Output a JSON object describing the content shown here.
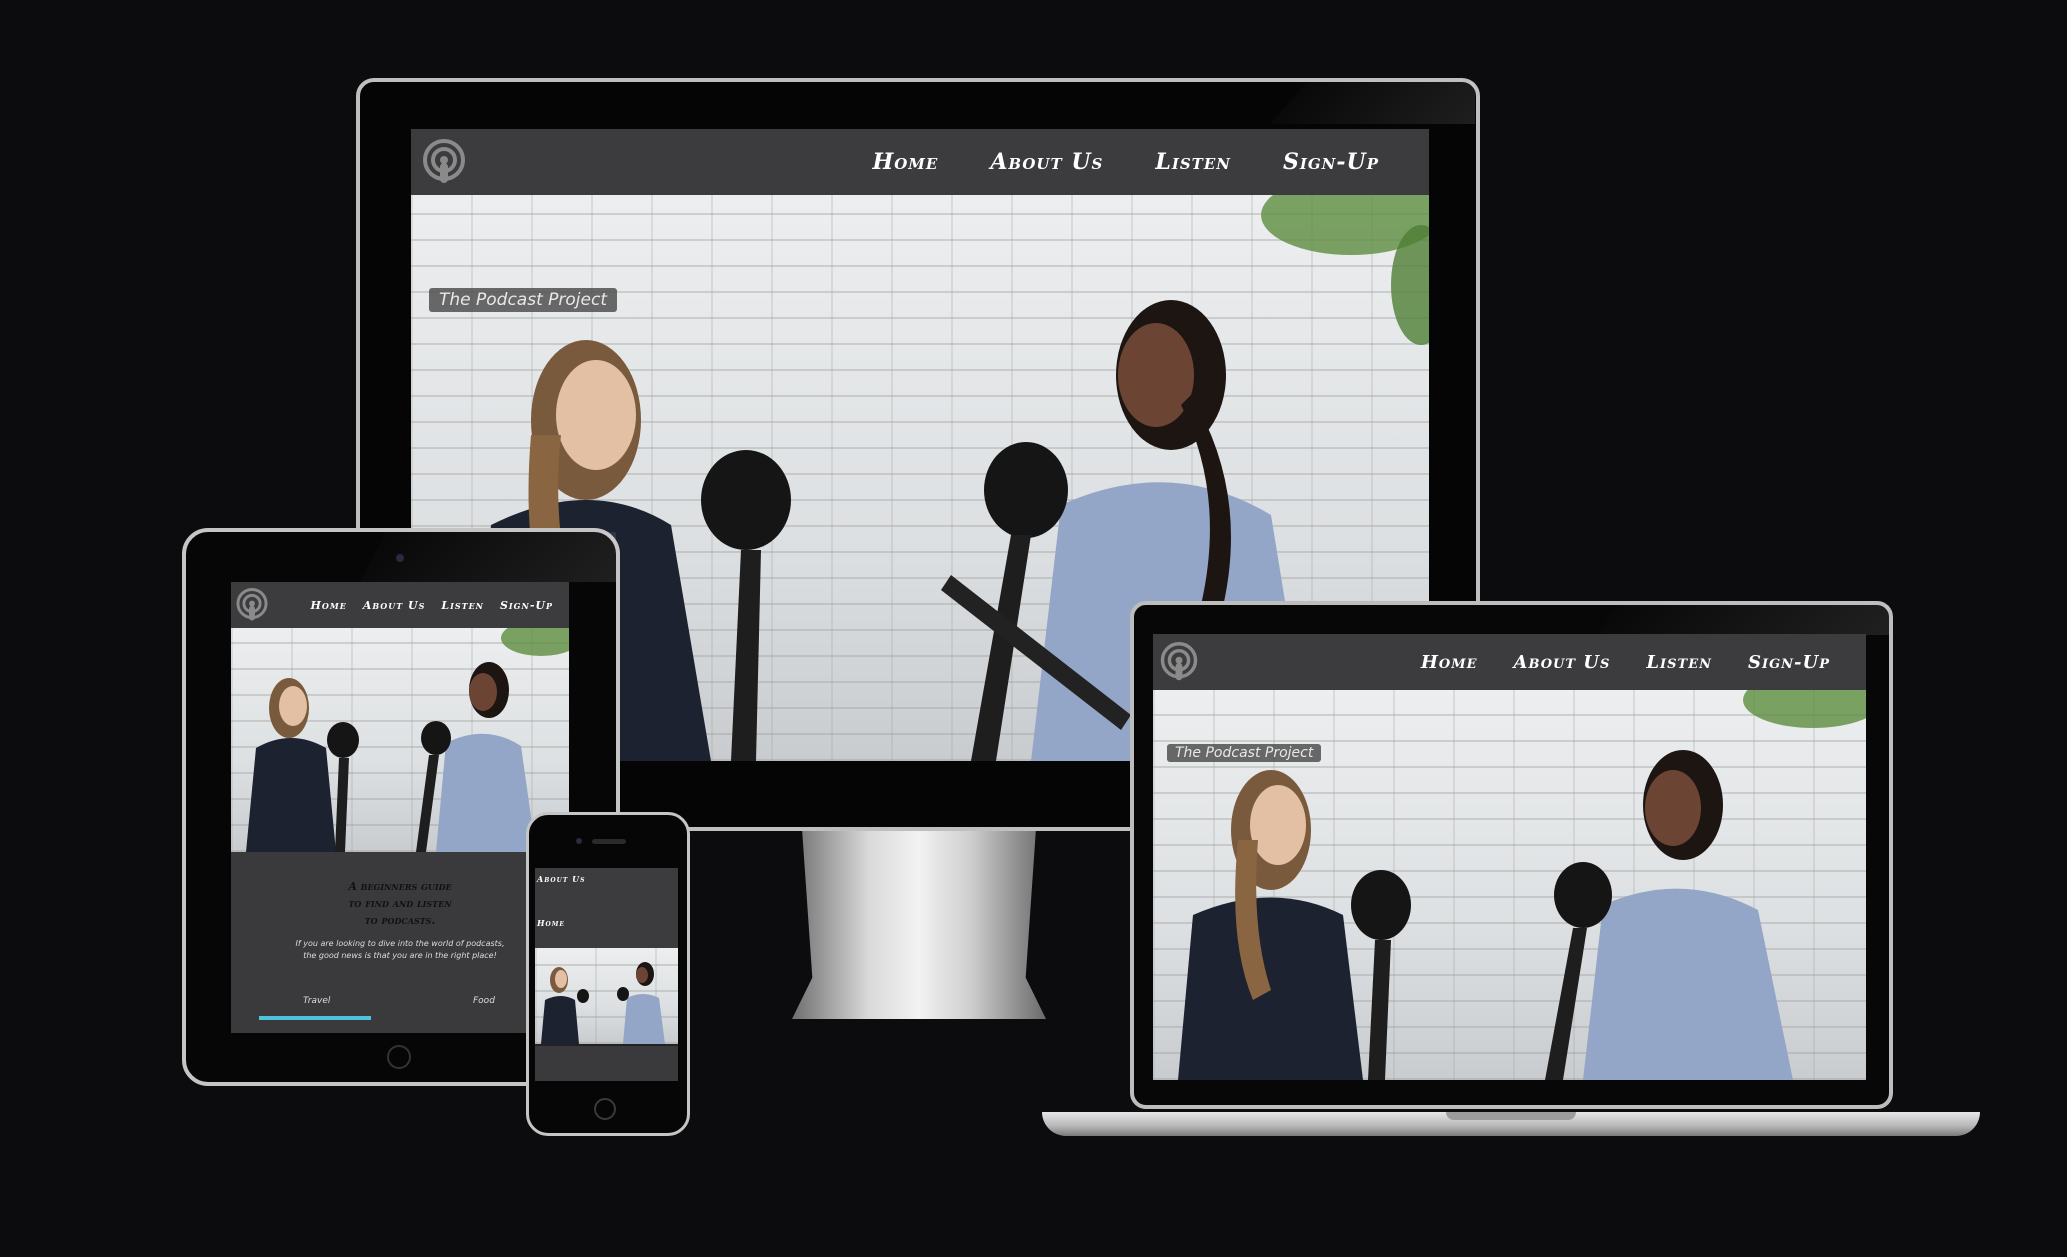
{
  "site": {
    "tagline": "The Podcast Project",
    "nav": {
      "home": "Home",
      "about": "About Us",
      "listen": "Listen",
      "signup": "Sign-Up"
    },
    "hero_heading": "A beginners guide to find and listen to podcasts.",
    "hero_heading_lines": [
      "A beginners guide",
      "to find and listen",
      "to podcasts."
    ],
    "hero_text_lines": [
      "If you are looking to dive into the world of podcasts,",
      "the good news is that you are in the right place!"
    ],
    "categories": [
      "Travel",
      "Food"
    ],
    "accent_color": "#4fc3d9"
  },
  "icons": {
    "logo": "podcast-icon"
  }
}
